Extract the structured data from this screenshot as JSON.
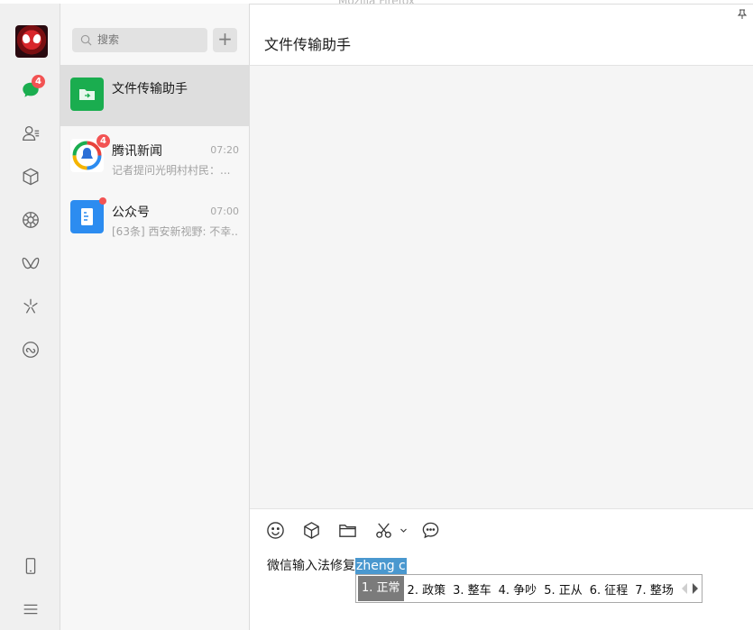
{
  "background_window": {
    "title": "Mozilla Firefox"
  },
  "nav": {
    "chat_badge": "4"
  },
  "search": {
    "placeholder": "搜索"
  },
  "chats": [
    {
      "name": "文件传输助手",
      "time": "",
      "preview": "",
      "icon": "file-transfer-icon",
      "color": "#1aad4f"
    },
    {
      "name": "腾讯新闻",
      "time": "07:20",
      "preview": "记者提问光明村村民：...",
      "icon": "tencent-news-icon",
      "badge": "4"
    },
    {
      "name": "公众号",
      "time": "07:00",
      "preview": "[63条] 西安新视野: 不幸...",
      "icon": "official-accounts-icon",
      "color": "#2c8cf0"
    }
  ],
  "pane": {
    "title": "文件传输助手"
  },
  "composer": {
    "committed_text": "微信输入法修复",
    "preedit_text": "zheng c"
  },
  "ime": {
    "candidates": [
      "1. 正常",
      "2. 政策",
      "3. 整车",
      "4. 争吵",
      "5. 正从",
      "6. 征程",
      "7. 整场"
    ]
  },
  "colors": {
    "accent_green": "#1aad4f",
    "badge_red": "#f25353",
    "preedit_blue": "#4a98cf"
  }
}
